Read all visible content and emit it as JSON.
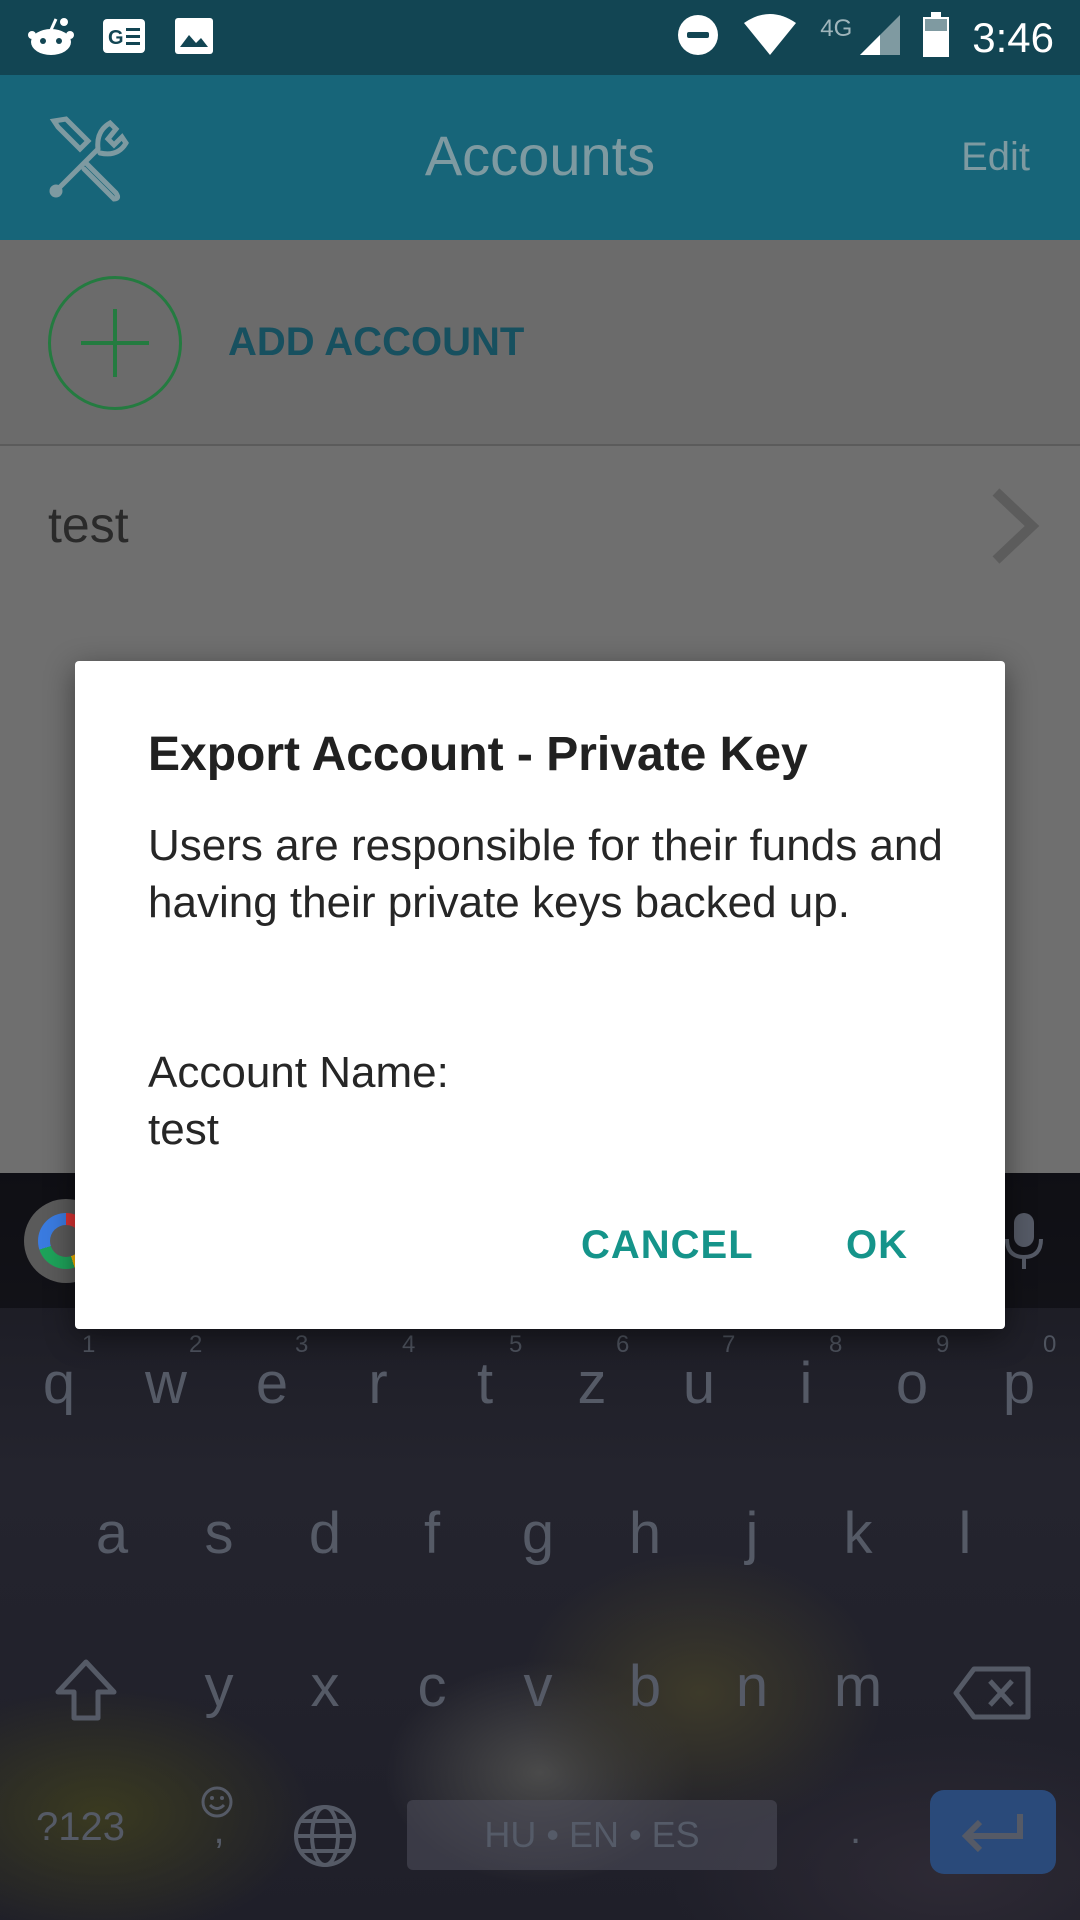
{
  "status_bar": {
    "time": "3:46",
    "network": "4G",
    "left_icons": [
      "reddit-icon",
      "news-icon",
      "image-icon"
    ],
    "right_icons": [
      "dnd-icon",
      "wifi-icon",
      "signal-icon",
      "battery-icon"
    ]
  },
  "app_bar": {
    "title": "Accounts",
    "edit_label": "Edit",
    "left_icon": "tools-icon",
    "color": "#176579"
  },
  "list": {
    "add_account_label": "ADD ACCOUNT",
    "accounts": [
      "test"
    ]
  },
  "dialog": {
    "title": "Export Account - Private Key",
    "body": "Users are responsible for their funds and having their private keys backed up.",
    "account_label": "Account Name:",
    "account_value": "test",
    "cancel_label": "CANCEL",
    "ok_label": "OK",
    "accent_color": "#15948a"
  },
  "keyboard": {
    "row1": [
      "q",
      "w",
      "e",
      "r",
      "t",
      "z",
      "u",
      "i",
      "o",
      "p"
    ],
    "row1_numbers": [
      "1",
      "2",
      "3",
      "4",
      "5",
      "6",
      "7",
      "8",
      "9",
      "0"
    ],
    "row2": [
      "a",
      "s",
      "d",
      "f",
      "g",
      "h",
      "j",
      "k",
      "l"
    ],
    "row3": [
      "y",
      "x",
      "c",
      "v",
      "b",
      "n",
      "m"
    ],
    "symbols_label": "?123",
    "space_label": "HU • EN • ES",
    "period": ".",
    "emoji_comma": ","
  }
}
